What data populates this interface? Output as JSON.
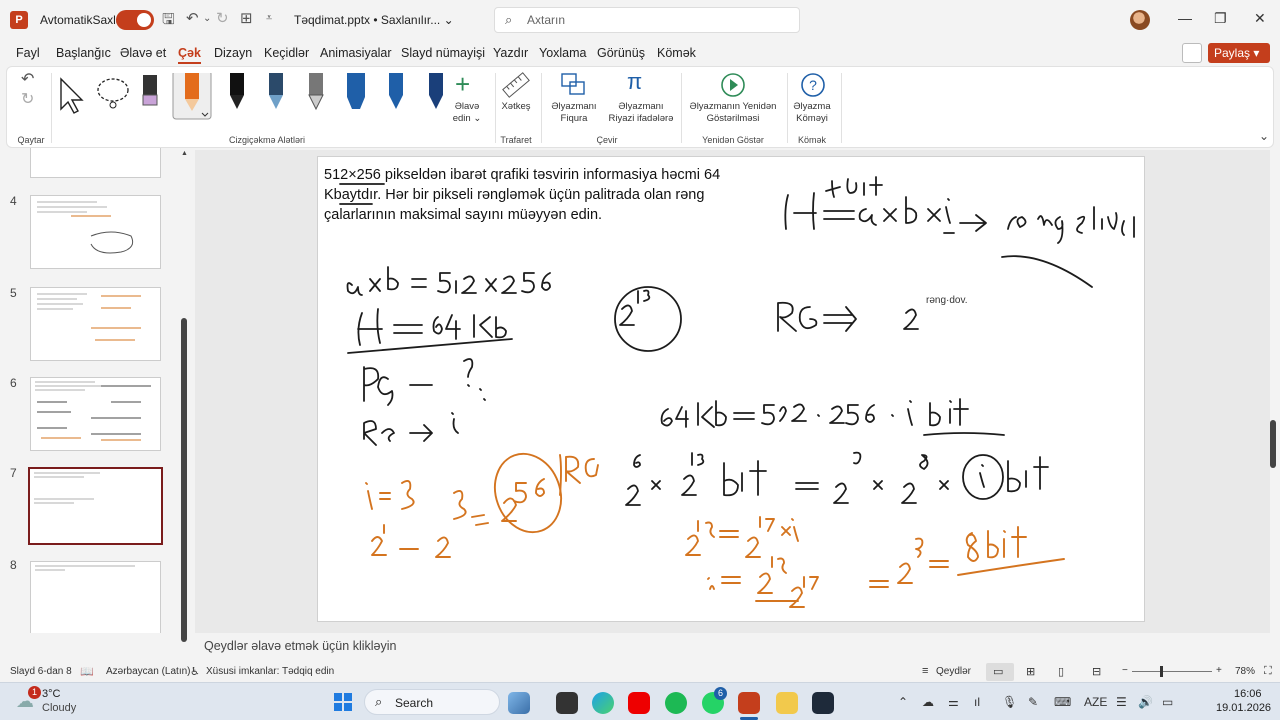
{
  "titlebar": {
    "logo": "P",
    "autosave": "AvtomatikSaxlama",
    "filename": "Təqdimat.pptx • Saxlanılır... ⌄",
    "search_placeholder": "Axtarın"
  },
  "menu": {
    "items": [
      "Fayl",
      "Başlanğıc",
      "Əlavə et",
      "Çək",
      "Dizayn",
      "Keçidlər",
      "Animasiyalar",
      "Slayd nümayişi",
      "Yazdır",
      "Yoxlama",
      "Görünüş",
      "Kömək"
    ],
    "active": "Çək",
    "share": "Paylaş ▾"
  },
  "ribbon": {
    "groups": {
      "undo": "Qaytar",
      "tools": "Cizgiçəkmə Alətləri",
      "stencils": "Trafaret",
      "convert": "Çevir",
      "replay": "Yenidən Göstər",
      "help": "Kömək"
    },
    "add_label": "Əlavə edin ⌄",
    "ruler_label": "Xətkeş",
    "ink_shape": "Əlyazmanı Fiqura",
    "ink_math": "Əlyazmanı Riyazi ifadələrə",
    "ink_replay": "Əlyazmanın Yenidən Göstərilməsi",
    "ink_help": "Əlyazma Köməyi",
    "colors": {
      "accent": "#c43e1c",
      "pen_orange": "#e36c1c",
      "pen_black": "#111111",
      "pen_blue": "#1f5fa8"
    }
  },
  "thumbs": {
    "numbers": [
      "4",
      "5",
      "6",
      "7",
      "8"
    ]
  },
  "slide": {
    "question": "512×256 pikseldən ibarət qrafiki təsvirin informasiya həcmi 64 Kbaytdır. Hər bir pikseli rəngləmək üçün palitrada olan rəng çalarlarının maksimal sayını müəyyən edin.",
    "ink_color": "#d4741f"
  },
  "notes": {
    "placeholder": "Qeydlər əlavə etmək üçün klikləyin"
  },
  "status": {
    "slide": "Slayd 6-dan 8",
    "lang": "Azərbaycan (Latın)",
    "access": "Xüsusi imkanlar: Tədqiq edin",
    "notes_btn": "Qeydlər",
    "zoom": "78%"
  },
  "taskbar": {
    "temp": "3°C",
    "weather": "Cloudy",
    "search": "Search",
    "lang": "AZE",
    "time": "16:06",
    "date": "19.01.2026",
    "badge": "1",
    "wa_badge": "6"
  }
}
